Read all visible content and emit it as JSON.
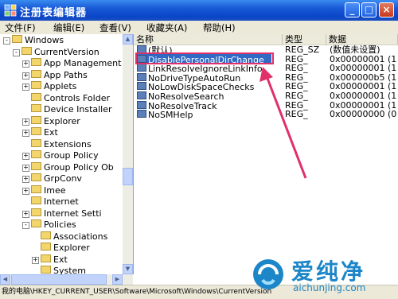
{
  "window": {
    "title": "注册表编辑器",
    "controls": [
      "_",
      "□",
      "×"
    ]
  },
  "menu": [
    "文件(F)",
    "编辑(E)",
    "查看(V)",
    "收藏夹(A)",
    "帮助(H)"
  ],
  "tree": [
    {
      "label": "Windows",
      "exp": "-",
      "indent": 0
    },
    {
      "label": "CurrentVersion",
      "exp": "-",
      "indent": 1
    },
    {
      "label": "App Management",
      "exp": "+",
      "indent": 2
    },
    {
      "label": "App Paths",
      "exp": "+",
      "indent": 2
    },
    {
      "label": "Applets",
      "exp": "+",
      "indent": 2
    },
    {
      "label": "Controls Folder",
      "exp": "",
      "indent": 2
    },
    {
      "label": "Device Installer",
      "exp": "",
      "indent": 2
    },
    {
      "label": "Explorer",
      "exp": "+",
      "indent": 2
    },
    {
      "label": "Ext",
      "exp": "+",
      "indent": 2
    },
    {
      "label": "Extensions",
      "exp": "",
      "indent": 2
    },
    {
      "label": "Group Policy",
      "exp": "+",
      "indent": 2
    },
    {
      "label": "Group Policy Ob",
      "exp": "+",
      "indent": 2
    },
    {
      "label": "GrpConv",
      "exp": "+",
      "indent": 2
    },
    {
      "label": "Imee",
      "exp": "+",
      "indent": 2
    },
    {
      "label": "Internet",
      "exp": "",
      "indent": 2
    },
    {
      "label": "Internet Setti",
      "exp": "+",
      "indent": 2
    },
    {
      "label": "Policies",
      "exp": "-",
      "indent": 2
    },
    {
      "label": "Associations",
      "exp": "",
      "indent": 3
    },
    {
      "label": "Explorer",
      "exp": "",
      "indent": 3
    },
    {
      "label": "Ext",
      "exp": "+",
      "indent": 3
    },
    {
      "label": "System",
      "exp": "",
      "indent": 3
    }
  ],
  "columns": [
    "名称",
    "类型",
    "数据"
  ],
  "rows": [
    {
      "name": "(默认)",
      "type": "REG_SZ",
      "data": "(数值未设置)"
    },
    {
      "name": "DisablePersonalDirChange",
      "type": "REG_",
      "data": "0x00000001 (1"
    },
    {
      "name": "LinkResolveIgnoreLinkInfo",
      "type": "REG_",
      "data": "0x00000001 (1"
    },
    {
      "name": "NoDriveTypeAutoRun",
      "type": "REG_",
      "data": "0x000000b5 (1"
    },
    {
      "name": "NoLowDiskSpaceChecks",
      "type": "REG_",
      "data": "0x00000001 (1"
    },
    {
      "name": "NoResolveSearch",
      "type": "REG_",
      "data": "0x00000001 (1"
    },
    {
      "name": "NoResolveTrack",
      "type": "REG_",
      "data": "0x00000001 (1"
    },
    {
      "name": "NoSMHelp",
      "type": "REG_",
      "data": "0x00000000 (0"
    }
  ],
  "status": "我的电脑\\HKEY_CURRENT_USER\\Software\\Microsoft\\Windows\\CurrentVersion",
  "watermark": {
    "brand": "爱纯净",
    "url": "aichunjing.com"
  },
  "colors": {
    "title_bar": "#0a45c8",
    "selection": "#316ac5",
    "annotation": "#e0306a"
  }
}
